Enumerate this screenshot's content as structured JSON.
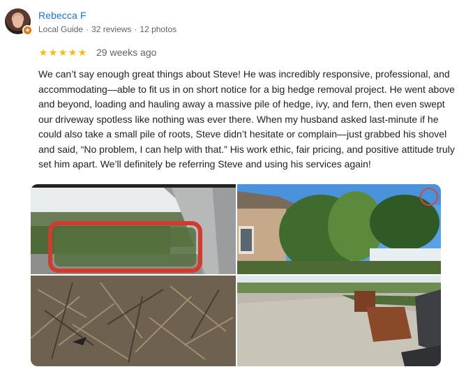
{
  "reviewer": {
    "name": "Rebecca F",
    "role": "Local Guide",
    "reviews": "32 reviews",
    "photos": "12 photos",
    "badge_icon": "local-guide-star-icon"
  },
  "rating": {
    "stars": 5,
    "max": 5,
    "time_ago": "29 weeks ago",
    "star_color": "#fbbc04"
  },
  "review_text": "We can’t say enough great things about Steve! He was incredibly responsive, professional, and accommodating—able to fit us in on short notice for a big hedge removal project. He went above and beyond, loading and hauling away a massive pile of hedge, ivy, and fern, then even swept our driveway spotless like nothing was ever there. When my husband asked last-minute if he could also take a small pile of roots, Steve didn’t hesitate or complain—just grabbed his shovel and said, “No problem, I can help with that.” His work ethic, fair pricing, and positive attitude truly set him apart. We’ll definitely be referring Steve and using his services again!",
  "colors": {
    "name_link": "#1a73e8",
    "meta_text": "#5f6368",
    "body_text": "#202124"
  },
  "photo_grid": [
    {
      "subject": "hedge-through-truck-mirror"
    },
    {
      "subject": "house-with-cut-hedge"
    },
    {
      "subject": "pile-of-roots-and-debris"
    },
    {
      "subject": "swept-driveway-with-planters"
    }
  ]
}
